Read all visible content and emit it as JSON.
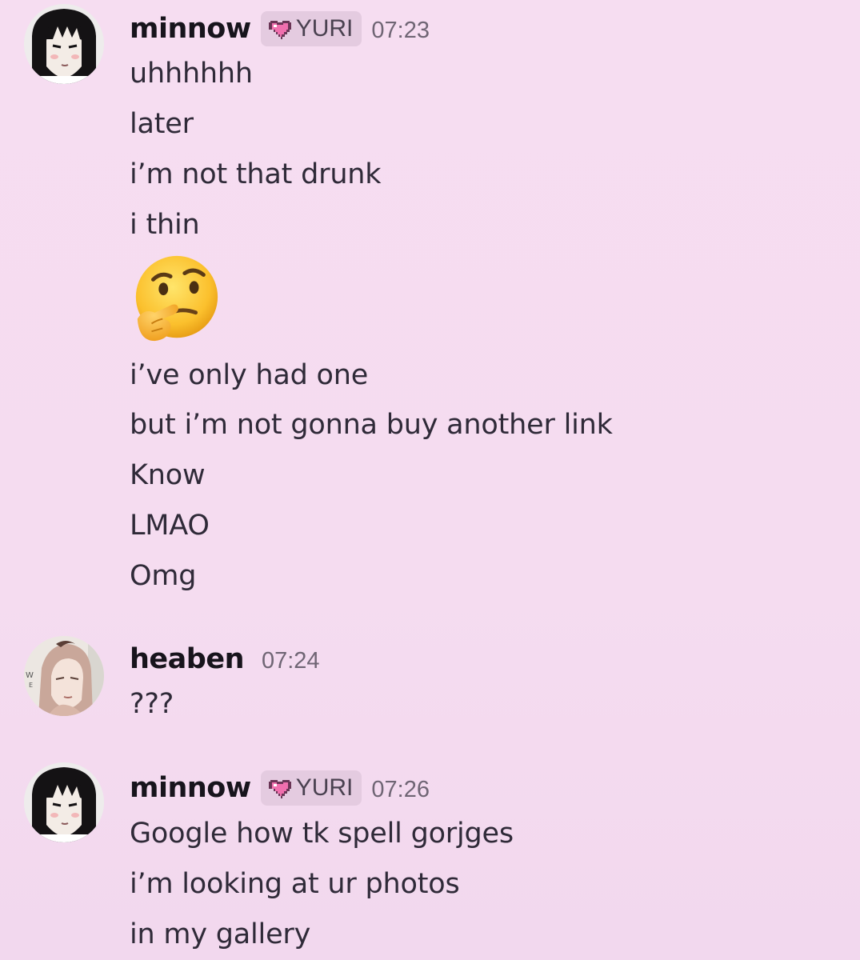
{
  "messages": [
    {
      "username": "minnow",
      "role": "YURI",
      "time": "07:23",
      "lines": [
        "uhhhhhh",
        "later",
        "i’m not that drunk",
        "i thin"
      ],
      "emoji": "thinking-face",
      "lines_after": [
        "i’ve only had one",
        "but i’m not gonna buy another link",
        "Know",
        "LMAO",
        "Omg"
      ]
    },
    {
      "username": "heaben",
      "time": "07:24",
      "lines": [
        "???"
      ]
    },
    {
      "username": "minnow",
      "role": "YURI",
      "time": "07:26",
      "lines": [
        "Google how tk spell gorjges",
        "i’m looking at ur photos",
        "in my gallery"
      ]
    }
  ],
  "colors": {
    "background": "#f5dcf0",
    "role_tag_bg": "#e4cbe0",
    "role_heart": "#f06fae",
    "text": "#2f2a38"
  }
}
